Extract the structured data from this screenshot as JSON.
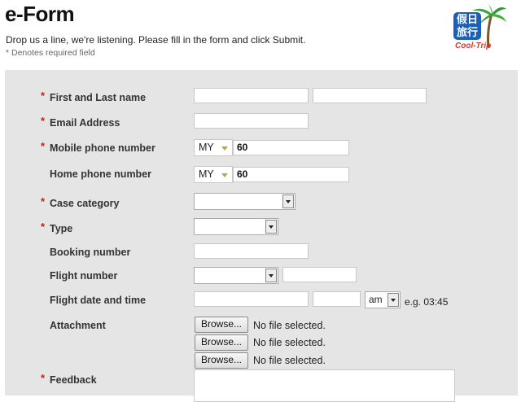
{
  "header": {
    "title": "e-Form",
    "intro": "Drop us a line, we're listening. Please fill in the form and click Submit.",
    "required_note": "* Denotes required field"
  },
  "logo": {
    "chinese": "假日旅行",
    "word": "Cool-Trip",
    "brand_color": "#1a5fb8"
  },
  "form": {
    "required_mark": "*",
    "labels": {
      "name": "First and Last name",
      "email": "Email Address",
      "mobile": "Mobile phone number",
      "home": "Home phone number",
      "case_category": "Case category",
      "type": "Type",
      "booking": "Booking number",
      "flight_number": "Flight number",
      "flight_datetime": "Flight date and time",
      "attachment": "Attachment",
      "feedback": "Feedback"
    },
    "mobile": {
      "country": "MY",
      "prefix": "60"
    },
    "home": {
      "country": "MY",
      "prefix": "60"
    },
    "ampm": "am",
    "time_hint": "e.g. 03:45",
    "browse_label": "Browse...",
    "no_file": "No file selected."
  },
  "colors": {
    "panel_bg": "#e5e5e5",
    "required": "#c62020"
  }
}
